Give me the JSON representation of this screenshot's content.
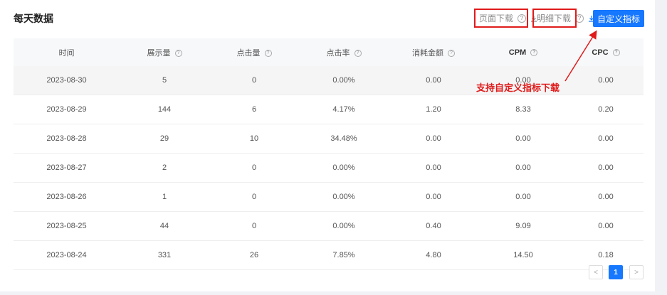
{
  "title": "每天数据",
  "toolbar": {
    "page_download": "页面下载",
    "detail_download": "明细下载",
    "custom_metrics": "自定义指标"
  },
  "icons": {
    "help": "question-circle-icon",
    "download": "download-icon"
  },
  "table": {
    "headers": [
      "时间",
      "展示量",
      "点击量",
      "点击率",
      "消耗金额",
      "CPM",
      "CPC"
    ],
    "rows": [
      [
        "2023-08-30",
        "5",
        "0",
        "0.00%",
        "0.00",
        "0.00",
        "0.00"
      ],
      [
        "2023-08-29",
        "144",
        "6",
        "4.17%",
        "1.20",
        "8.33",
        "0.20"
      ],
      [
        "2023-08-28",
        "29",
        "10",
        "34.48%",
        "0.00",
        "0.00",
        "0.00"
      ],
      [
        "2023-08-27",
        "2",
        "0",
        "0.00%",
        "0.00",
        "0.00",
        "0.00"
      ],
      [
        "2023-08-26",
        "1",
        "0",
        "0.00%",
        "0.00",
        "0.00",
        "0.00"
      ],
      [
        "2023-08-25",
        "44",
        "0",
        "0.00%",
        "0.40",
        "9.09",
        "0.00"
      ],
      [
        "2023-08-24",
        "331",
        "26",
        "7.85%",
        "4.80",
        "14.50",
        "0.18"
      ]
    ]
  },
  "annotation": "支持自定义指标下载",
  "pagination": {
    "prev": "<",
    "current": "1",
    "next": ">"
  },
  "colors": {
    "primary": "#1677ff",
    "annotation": "#e01b1b"
  }
}
